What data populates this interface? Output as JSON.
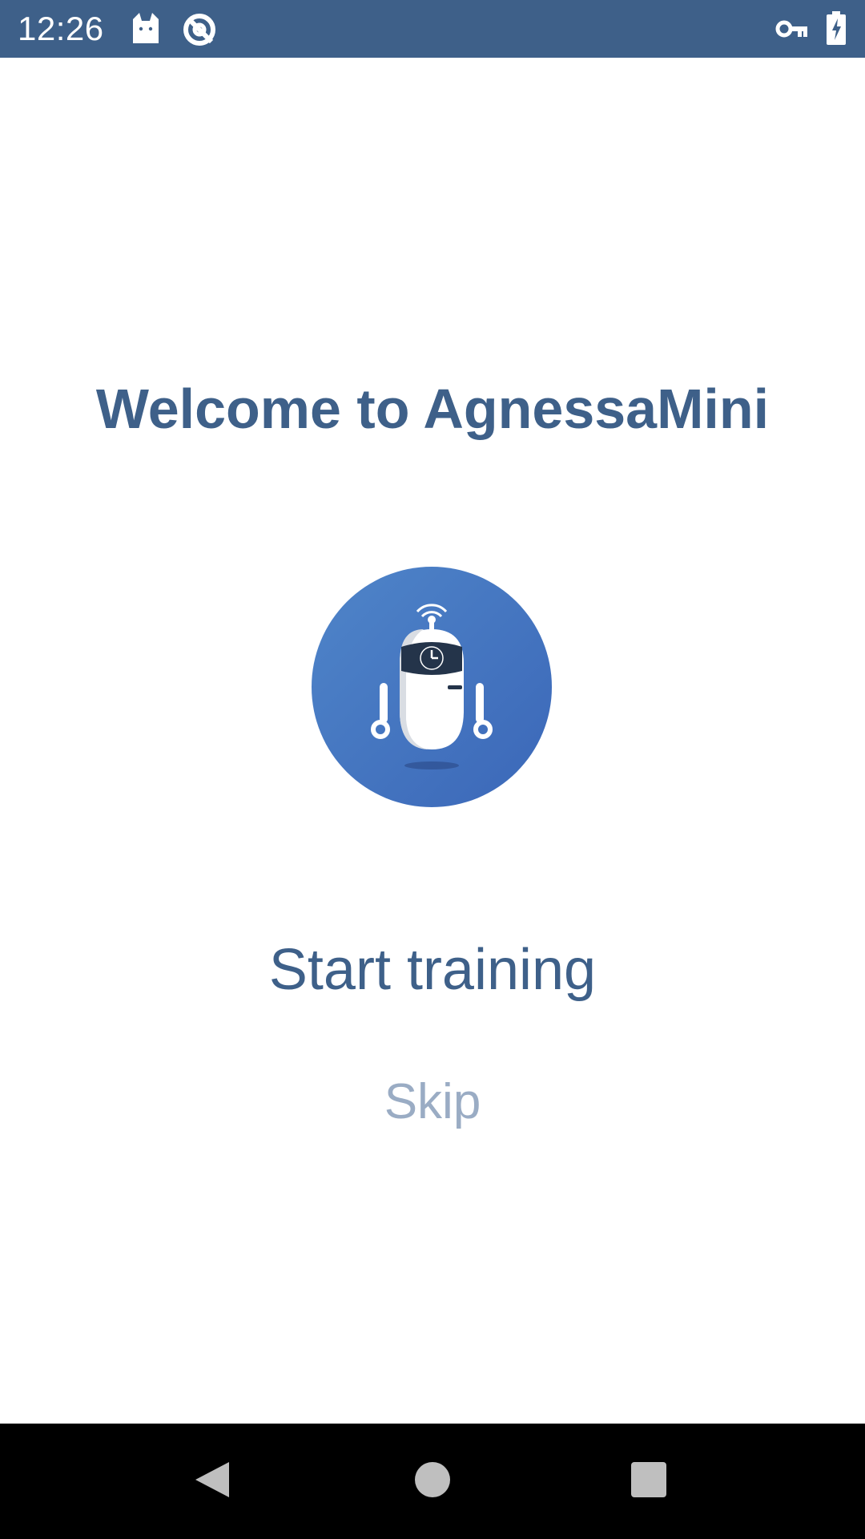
{
  "status_bar": {
    "time": "12:26",
    "icons": [
      "cat-icon",
      "sync-disabled-icon",
      "vpn-key-icon",
      "battery-charging-icon"
    ],
    "color": "#3e6089"
  },
  "main": {
    "title": "Welcome to AgnessaMini",
    "logo_icon": "robot-icon",
    "start_label": "Start training",
    "skip_label": "Skip",
    "accent_color": "#3e6089",
    "logo_color": "#4a7cc4"
  },
  "nav_bar": {
    "buttons": [
      "back-icon",
      "home-icon",
      "recents-icon"
    ]
  }
}
